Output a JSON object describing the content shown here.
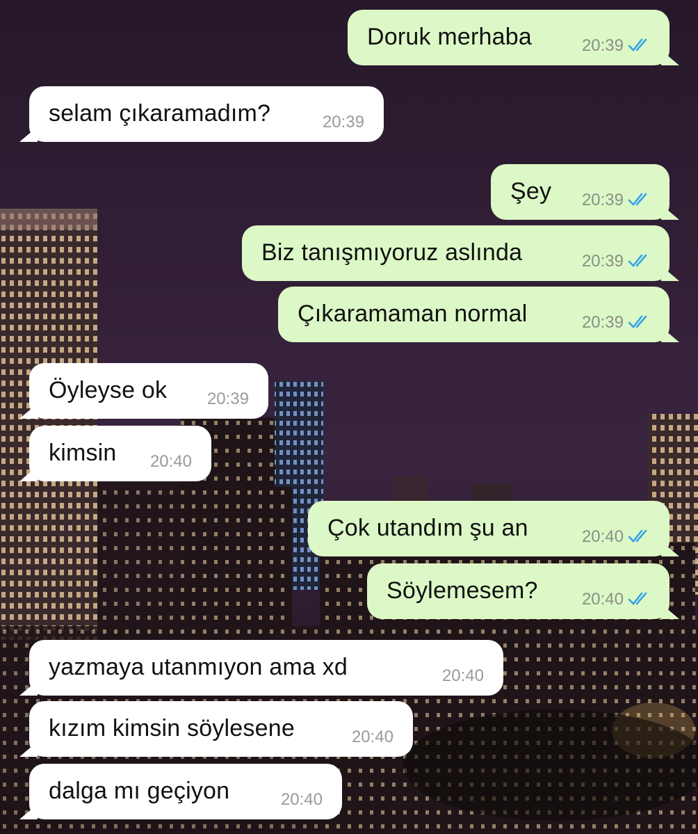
{
  "messages": [
    {
      "text": "Doruk merhaba",
      "time": "20:39",
      "dir": "out",
      "read": true
    },
    {
      "text": "selam çıkaramadım?",
      "time": "20:39",
      "dir": "in"
    },
    {
      "text": "Şey",
      "time": "20:39",
      "dir": "out",
      "read": true
    },
    {
      "text": "Biz tanışmıyoruz aslında",
      "time": "20:39",
      "dir": "out",
      "read": true
    },
    {
      "text": "Çıkaramaman normal",
      "time": "20:39",
      "dir": "out",
      "read": true
    },
    {
      "text": "Öyleyse ok",
      "time": "20:39",
      "dir": "in"
    },
    {
      "text": "kimsin",
      "time": "20:40",
      "dir": "in"
    },
    {
      "text": "Çok utandım şu an",
      "time": "20:40",
      "dir": "out",
      "read": true
    },
    {
      "text": "Söylemesem?",
      "time": "20:40",
      "dir": "out",
      "read": true
    },
    {
      "text": "yazmaya utanmıyon ama xd",
      "time": "20:40",
      "dir": "in"
    },
    {
      "text": "kızım kimsin söylesene",
      "time": "20:40",
      "dir": "in"
    },
    {
      "text": "dalga mı geçiyon",
      "time": "20:40",
      "dir": "in"
    }
  ],
  "colors": {
    "outgoing_bubble": "#dcf8c6",
    "incoming_bubble": "#ffffff",
    "read_ticks": "#34a3e8",
    "wallpaper_sky": "#2c1c34"
  },
  "icons": {
    "read_receipt": "double-check-icon",
    "wallpaper": "night-city-wallpaper"
  }
}
